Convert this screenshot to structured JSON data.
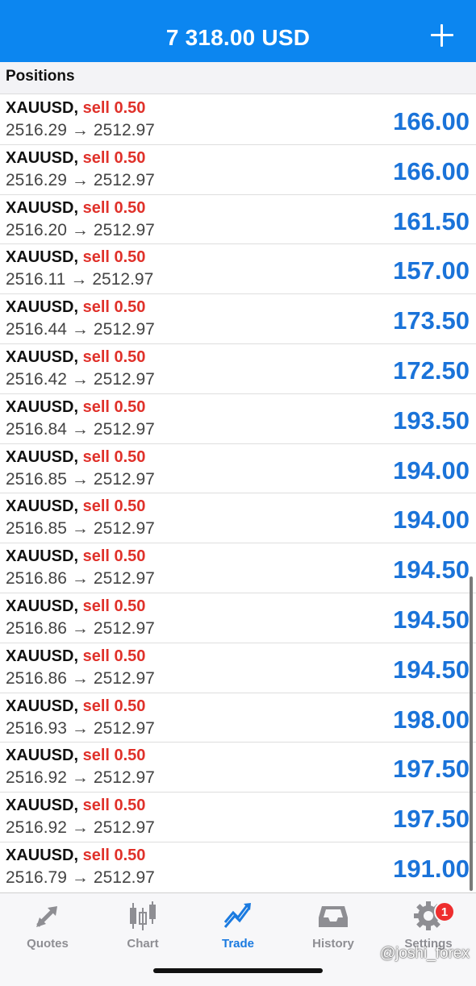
{
  "header": {
    "title": "7 318.00 USD",
    "add_icon": "plus-icon"
  },
  "section": {
    "title": "Positions"
  },
  "positions": [
    {
      "symbol": "XAUUSD",
      "type": "sell 0.50",
      "open": "2516.29",
      "current": "2512.97",
      "profit": "166.00"
    },
    {
      "symbol": "XAUUSD",
      "type": "sell 0.50",
      "open": "2516.29",
      "current": "2512.97",
      "profit": "166.00"
    },
    {
      "symbol": "XAUUSD",
      "type": "sell 0.50",
      "open": "2516.20",
      "current": "2512.97",
      "profit": "161.50"
    },
    {
      "symbol": "XAUUSD",
      "type": "sell 0.50",
      "open": "2516.11",
      "current": "2512.97",
      "profit": "157.00"
    },
    {
      "symbol": "XAUUSD",
      "type": "sell 0.50",
      "open": "2516.44",
      "current": "2512.97",
      "profit": "173.50"
    },
    {
      "symbol": "XAUUSD",
      "type": "sell 0.50",
      "open": "2516.42",
      "current": "2512.97",
      "profit": "172.50"
    },
    {
      "symbol": "XAUUSD",
      "type": "sell 0.50",
      "open": "2516.84",
      "current": "2512.97",
      "profit": "193.50"
    },
    {
      "symbol": "XAUUSD",
      "type": "sell 0.50",
      "open": "2516.85",
      "current": "2512.97",
      "profit": "194.00"
    },
    {
      "symbol": "XAUUSD",
      "type": "sell 0.50",
      "open": "2516.85",
      "current": "2512.97",
      "profit": "194.00"
    },
    {
      "symbol": "XAUUSD",
      "type": "sell 0.50",
      "open": "2516.86",
      "current": "2512.97",
      "profit": "194.50"
    },
    {
      "symbol": "XAUUSD",
      "type": "sell 0.50",
      "open": "2516.86",
      "current": "2512.97",
      "profit": "194.50"
    },
    {
      "symbol": "XAUUSD",
      "type": "sell 0.50",
      "open": "2516.86",
      "current": "2512.97",
      "profit": "194.50"
    },
    {
      "symbol": "XAUUSD",
      "type": "sell 0.50",
      "open": "2516.93",
      "current": "2512.97",
      "profit": "198.00"
    },
    {
      "symbol": "XAUUSD",
      "type": "sell 0.50",
      "open": "2516.92",
      "current": "2512.97",
      "profit": "197.50"
    },
    {
      "symbol": "XAUUSD",
      "type": "sell 0.50",
      "open": "2516.92",
      "current": "2512.97",
      "profit": "197.50"
    },
    {
      "symbol": "XAUUSD",
      "type": "sell 0.50",
      "open": "2516.79",
      "current": "2512.97",
      "profit": "191.00"
    }
  ],
  "arrow": "→",
  "tabs": [
    {
      "label": "Quotes",
      "icon": "quotes-arrows-icon",
      "active": false
    },
    {
      "label": "Chart",
      "icon": "candlestick-chart-icon",
      "active": false
    },
    {
      "label": "Trade",
      "icon": "trade-trend-icon",
      "active": true
    },
    {
      "label": "History",
      "icon": "history-inbox-icon",
      "active": false
    },
    {
      "label": "Settings",
      "icon": "gear-icon",
      "active": false,
      "badge": "1"
    }
  ],
  "watermark": "@joshi_forex",
  "colors": {
    "header_bg": "#0c86f0",
    "sell": "#e0312a",
    "profit": "#1a73d9",
    "tab_active": "#1a7ae0",
    "tab_inactive": "#8e8e93",
    "badge": "#ee2e2e"
  }
}
